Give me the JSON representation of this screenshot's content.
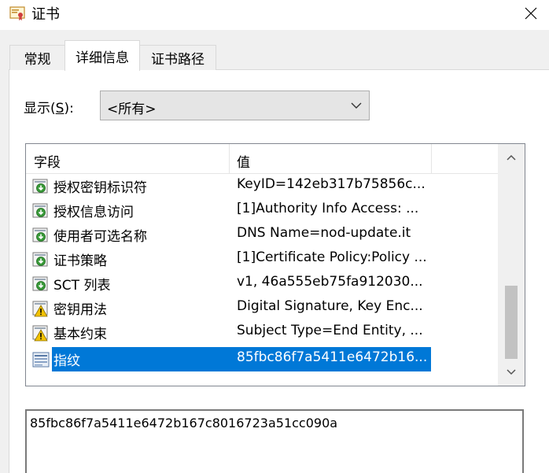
{
  "window": {
    "title": "证书",
    "icon": "certificate-icon",
    "close_icon": "close-icon"
  },
  "tabs": [
    {
      "label": "常规",
      "active": false
    },
    {
      "label": "详细信息",
      "active": true
    },
    {
      "label": "证书路径",
      "active": false
    }
  ],
  "show": {
    "label_prefix": "显示(",
    "label_accel": "S",
    "label_suffix": "):",
    "selected": "<所有>"
  },
  "list": {
    "columns": [
      "字段",
      "值"
    ],
    "rows": [
      {
        "field": "授权密钥标识符",
        "value": "KeyID=142eb317b75856c...",
        "icon": "extension-download-icon"
      },
      {
        "field": "授权信息访问",
        "value": "[1]Authority Info Access: ...",
        "icon": "extension-download-icon"
      },
      {
        "field": "使用者可选名称",
        "value": "DNS Name=nod-update.it",
        "icon": "extension-download-icon"
      },
      {
        "field": "证书策略",
        "value": "[1]Certificate Policy:Policy ...",
        "icon": "extension-download-icon"
      },
      {
        "field": "SCT 列表",
        "value": "v1, 46a555eb75fa912030...",
        "icon": "extension-download-icon"
      },
      {
        "field": "密钥用法",
        "value": "Digital Signature, Key Enc...",
        "icon": "critical-extension-icon"
      },
      {
        "field": "基本约束",
        "value": "Subject Type=End Entity, ...",
        "icon": "critical-extension-icon"
      },
      {
        "field": "指纹",
        "value": "85fbc86f7a5411e6472b16...",
        "icon": "property-icon",
        "selected": true
      }
    ]
  },
  "detail": {
    "value": "85fbc86f7a5411e6472b167c8016723a51cc090a"
  },
  "colors": {
    "selection": "#0078d7",
    "window_bg": "#f0f0f0"
  }
}
